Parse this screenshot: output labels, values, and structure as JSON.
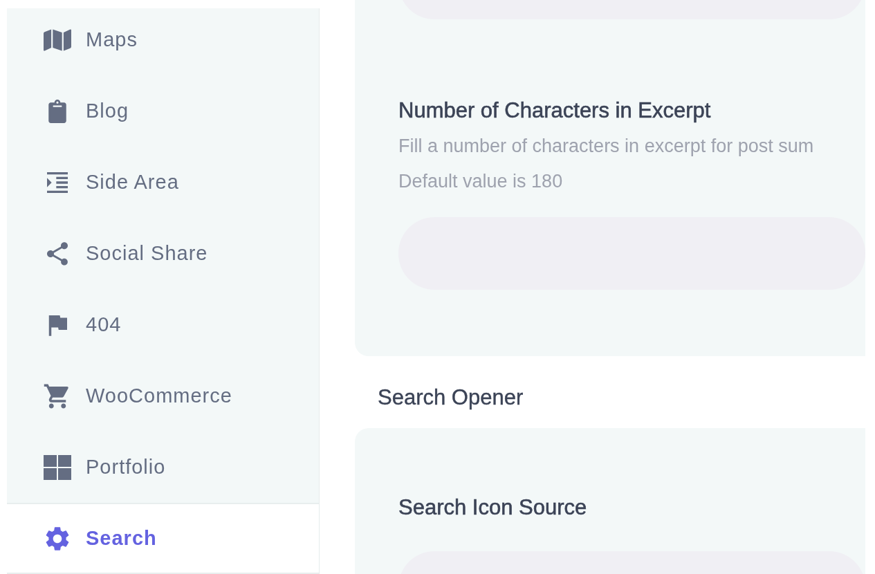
{
  "sidebar": {
    "items": [
      {
        "label": "Maps",
        "selected": false
      },
      {
        "label": "Blog",
        "selected": false
      },
      {
        "label": "Side Area",
        "selected": false
      },
      {
        "label": "Social Share",
        "selected": false
      },
      {
        "label": "404",
        "selected": false
      },
      {
        "label": "WooCommerce",
        "selected": false
      },
      {
        "label": "Portfolio",
        "selected": false
      },
      {
        "label": "Search",
        "selected": true
      }
    ]
  },
  "cards": [
    {
      "settings": [
        {
          "kind": "field"
        },
        {
          "kind": "option",
          "title": "Number of Characters in Excerpt",
          "description": [
            "Fill a number of characters in excerpt for post sum",
            "Default value is 180"
          ]
        }
      ]
    },
    {
      "heading": "Search Opener",
      "settings": [
        {
          "kind": "option",
          "title": "Search Icon Source"
        }
      ]
    }
  ]
}
